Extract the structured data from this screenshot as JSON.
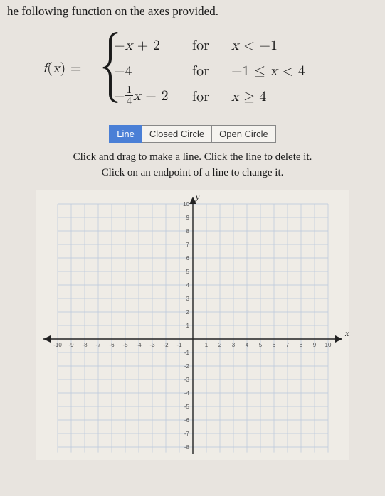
{
  "heading": "he following function on the axes provided.",
  "formula": {
    "lhs": "f(x) =",
    "pieces": [
      {
        "expr_plain": "−x + 2",
        "for": "for",
        "domain": "x < −1"
      },
      {
        "expr_plain": "−4",
        "for": "for",
        "domain": "−1 ≤ x < 4"
      },
      {
        "expr_frac": {
          "neg": "−",
          "num": "1",
          "den": "4",
          "rest": "x − 2"
        },
        "for": "for",
        "domain": "x ≥ 4"
      }
    ]
  },
  "tools": {
    "line": "Line",
    "closed": "Closed Circle",
    "open": "Open Circle",
    "active": "line"
  },
  "instructions": {
    "line1": "Click and drag to make a line. Click the line to delete it.",
    "line2": "Click on an endpoint of a line to change it."
  },
  "axes": {
    "xlabel": "x",
    "ylabel": "y",
    "xticks": [
      "-10",
      "-9",
      "-8",
      "-7",
      "-6",
      "-5",
      "-4",
      "-3",
      "-2",
      "-1",
      "1",
      "2",
      "3",
      "4",
      "5",
      "6",
      "7",
      "8",
      "9",
      "10"
    ],
    "yticks_pos": [
      "1",
      "2",
      "3",
      "4",
      "5",
      "6",
      "7",
      "8",
      "9",
      "10"
    ],
    "yticks_neg": [
      "-1",
      "-2",
      "-3",
      "-4",
      "-5",
      "-6",
      "-7",
      "-8"
    ]
  }
}
